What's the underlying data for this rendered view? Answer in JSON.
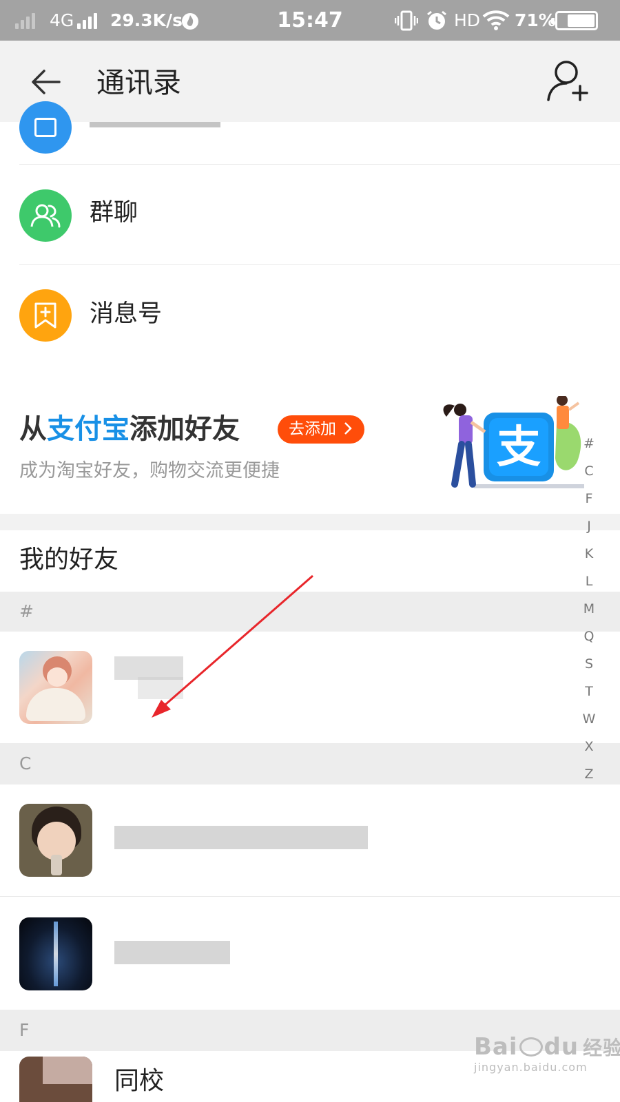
{
  "status_bar": {
    "network": "4G",
    "speed": "29.3K/s",
    "time": "15:47",
    "hd": "HD",
    "battery": "71%"
  },
  "nav": {
    "title": "通讯录"
  },
  "menu_items": [
    {
      "label": "群聊",
      "icon": "group-icon",
      "color": "#3ec96b"
    },
    {
      "label": "消息号",
      "icon": "bookmark-add-icon",
      "color": "#ffa40f"
    }
  ],
  "banner": {
    "prefix": "从",
    "brand": "支付宝",
    "suffix": "添加好友",
    "button": "去添加",
    "subtitle": "成为淘宝好友，购物交流更便捷",
    "brand_color": "#1890e6",
    "button_color": "#ff4d0a"
  },
  "friends_section": {
    "title": "我的好友"
  },
  "groups": [
    {
      "letter": "#"
    },
    {
      "letter": "C"
    },
    {
      "letter": "F"
    }
  ],
  "friends": [
    {
      "name": "",
      "group": "#",
      "avatar": "anime-girl-avatar"
    },
    {
      "name": "",
      "group": "C",
      "avatar": "child-photo-avatar"
    },
    {
      "name": "",
      "group": "C",
      "avatar": "night-sky-avatar"
    },
    {
      "name": "同校",
      "group": "F",
      "avatar": "photo-avatar"
    }
  ],
  "index_letters": [
    "#",
    "C",
    "F",
    "J",
    "K",
    "L",
    "M",
    "Q",
    "S",
    "T",
    "W",
    "X",
    "Z"
  ],
  "watermark": {
    "brand": "Bai",
    "brand2": "du",
    "label": "经验",
    "url": "jingyan.baidu.com"
  }
}
